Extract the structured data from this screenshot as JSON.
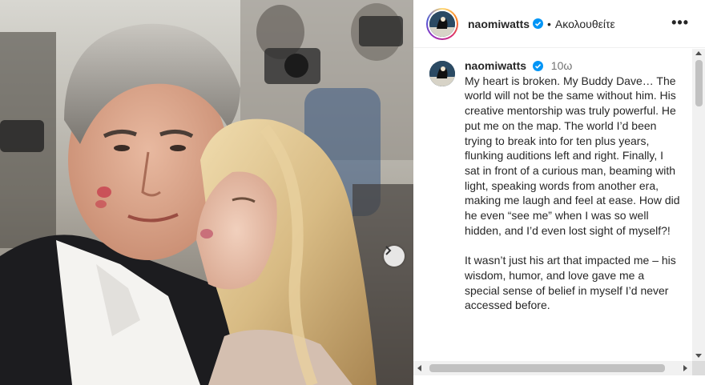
{
  "post": {
    "username": "naomiwatts",
    "follow_label": "Ακολουθείτε",
    "separator": "•",
    "more_label": "•••",
    "time": "10ω",
    "caption_p1": "My heart is broken. My Buddy Dave… The world will not be the same without him. His creative mentorship was truly powerful. He put me on the map. The world I’d been trying to break into for ten plus years, flunking auditions left and right. Finally, I sat in front of a curious man, beaming with light, speaking words from another era, making me laugh and feel at ease. How did he even “see me” when I was so well hidden, and I’d even lost sight of myself?!",
    "caption_p2": "It wasn’t just his art that impacted me – his wisdom, humor, and love gave me a special sense of belief in myself I’d never accessed before."
  },
  "icons": {
    "verified": "verified-badge-icon",
    "more": "more-options-icon",
    "next": "chevron-right-icon"
  },
  "colors": {
    "verified_blue": "#0095f6",
    "text": "#262626",
    "muted": "#737373"
  }
}
